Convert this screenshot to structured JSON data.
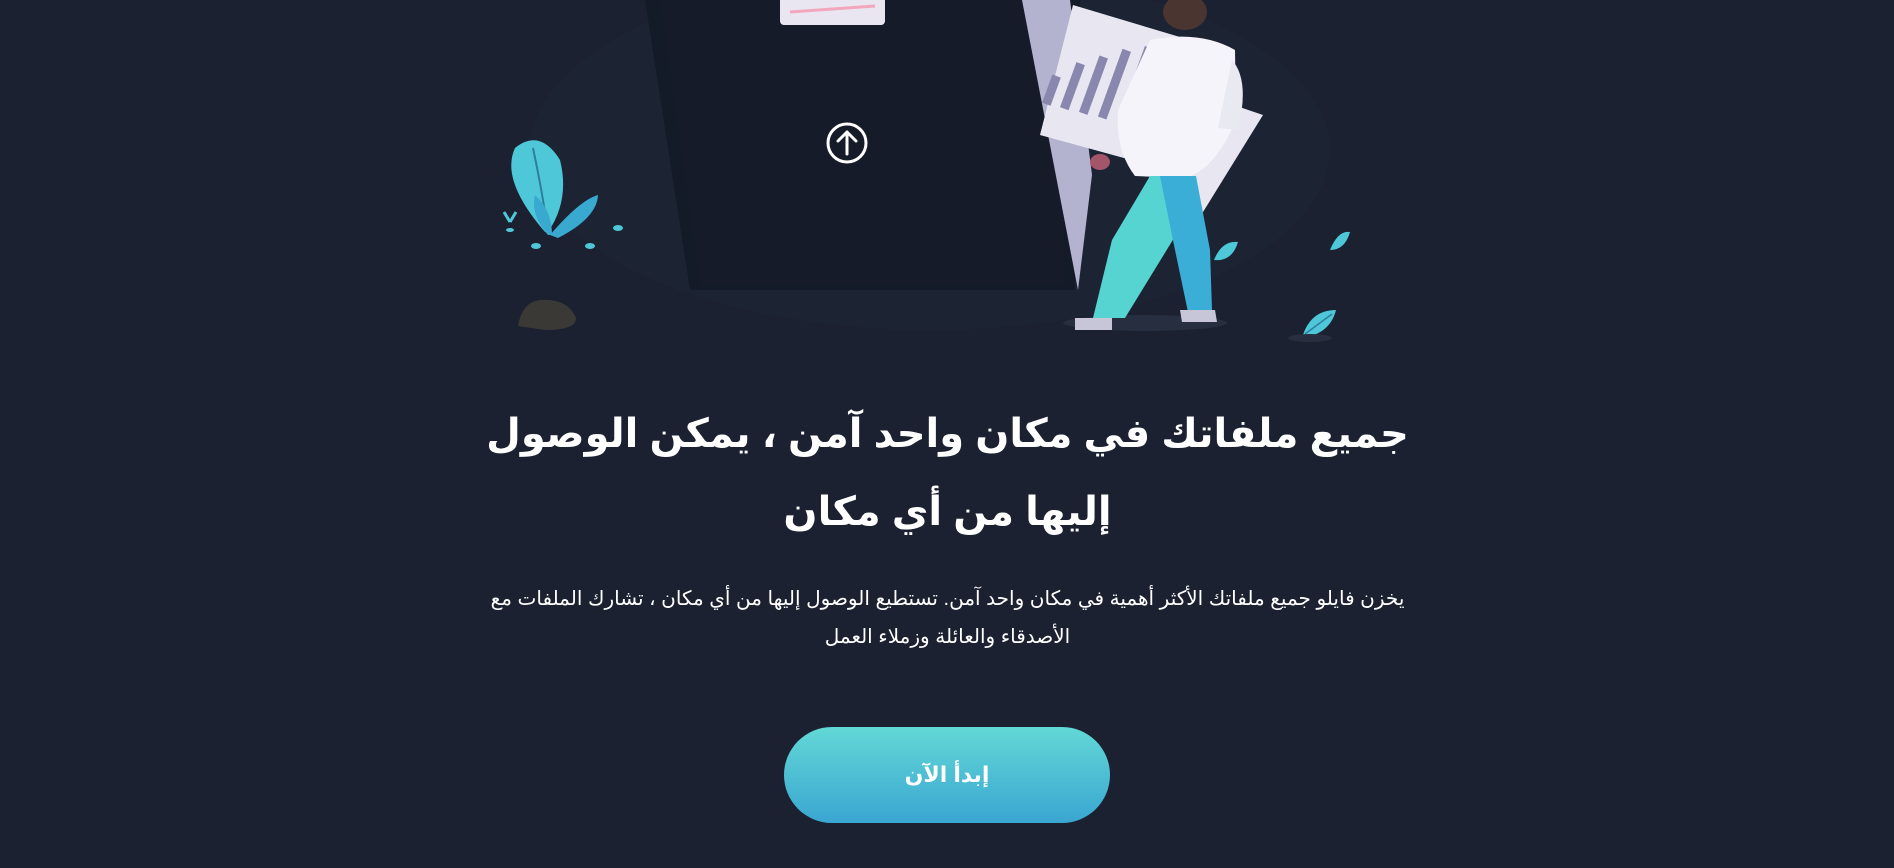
{
  "hero": {
    "title": "جميع ملفاتك في مكان واحد آمن ، يمكن الوصول إليها من أي مكان",
    "description": "يخزن فايلو جميع ملفاتك الأكثر أهمية في مكان واحد آمن. تستطيع الوصول إليها من أي مكان ، تشارك الملفات مع الأصدقاء والعائلة وزملاء العمل",
    "cta_label": "إبدأ الآن"
  },
  "illustration": {
    "icon": "upload-arrow-icon"
  },
  "colors": {
    "background": "#1b2130",
    "accent_top": "#62d8d6",
    "accent_bottom": "#3aa6d2",
    "text": "#ffffff"
  }
}
